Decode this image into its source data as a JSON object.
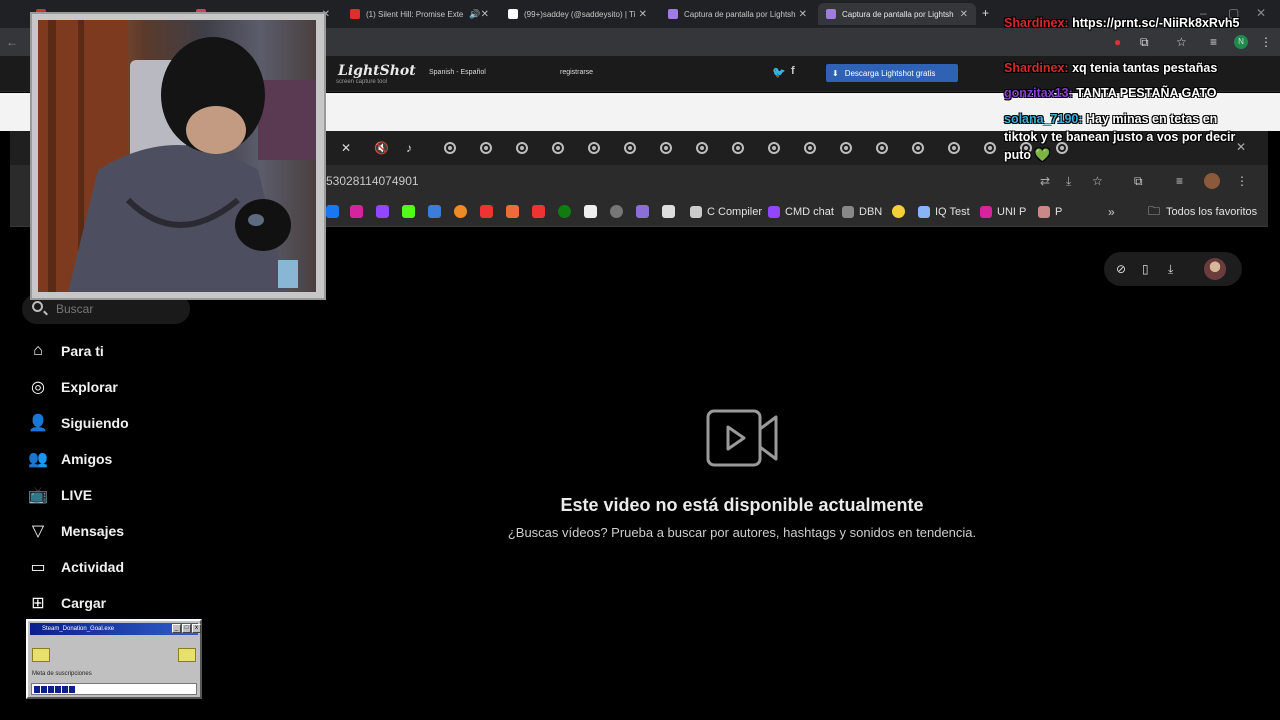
{
  "outer_browser": {
    "tabs": [
      {
        "label": "",
        "color": "#d03030"
      },
      {
        "label": "",
        "color": "#d04060"
      },
      {
        "label": "(1) Silent Hill: Promise Exte",
        "color": "#e22d2d"
      },
      {
        "label": "(99+)saddey (@saddeysito) | Ti",
        "color": "#fff"
      },
      {
        "label": "Captura de pantalla por Lightsh",
        "color": "#a07ce0"
      },
      {
        "label": "Captura de pantalla por Lightsh",
        "color": "#a07ce0"
      }
    ],
    "new_tab": "+"
  },
  "lightshot": {
    "logo": "LightShot",
    "logo_sub": "screen capture tool",
    "language": "Spanish - Español",
    "register": "registrarse",
    "download_button": "Descarga Lightshot gratis"
  },
  "inner_browser": {
    "url": "53028114074901",
    "bookmarks": [
      "C Compiler",
      "CMD chat",
      "DBN",
      "IQ Test",
      "UNI P",
      "P"
    ],
    "favorites_folder": "Todos los favoritos"
  },
  "tiktok": {
    "search_placeholder": "Buscar",
    "nav": [
      {
        "label": "Para ti",
        "icon": "home-icon"
      },
      {
        "label": "Explorar",
        "icon": "compass-icon"
      },
      {
        "label": "Siguiendo",
        "icon": "following-icon"
      },
      {
        "label": "Amigos",
        "icon": "friends-icon"
      },
      {
        "label": "LIVE",
        "icon": "live-icon"
      },
      {
        "label": "Mensajes",
        "icon": "messages-icon"
      },
      {
        "label": "Actividad",
        "icon": "activity-icon"
      },
      {
        "label": "Cargar",
        "icon": "upload-icon"
      }
    ],
    "unavailable_title": "Este video no está disponible actualmente",
    "unavailable_subtitle": "¿Buscas vídeos? Prueba a buscar por autores, hashtags y sonidos en tendencia."
  },
  "chat": {
    "messages": [
      {
        "user": "Shardinex:",
        "text": "https://prnt.sc/-NiiRk8xRvh5",
        "color": "#d62a2a"
      },
      {
        "user": "Shardinex:",
        "text": "xq tenia tantas pestañas",
        "color": "#d62a2a"
      },
      {
        "user": "gonzitax13:",
        "text": "TANTA PESTAÑA GATO",
        "color": "#8a3fd1"
      },
      {
        "user": "solana_7190:",
        "text": "Hay minas en tetas en tiktok y te banean justo a vos por decir puto 💚",
        "color": "#3ab0d8"
      }
    ]
  },
  "widget": {
    "title": "Steam_Donation_Goal.exe",
    "label": "Meta de suscripciones",
    "progress": 0.3
  }
}
